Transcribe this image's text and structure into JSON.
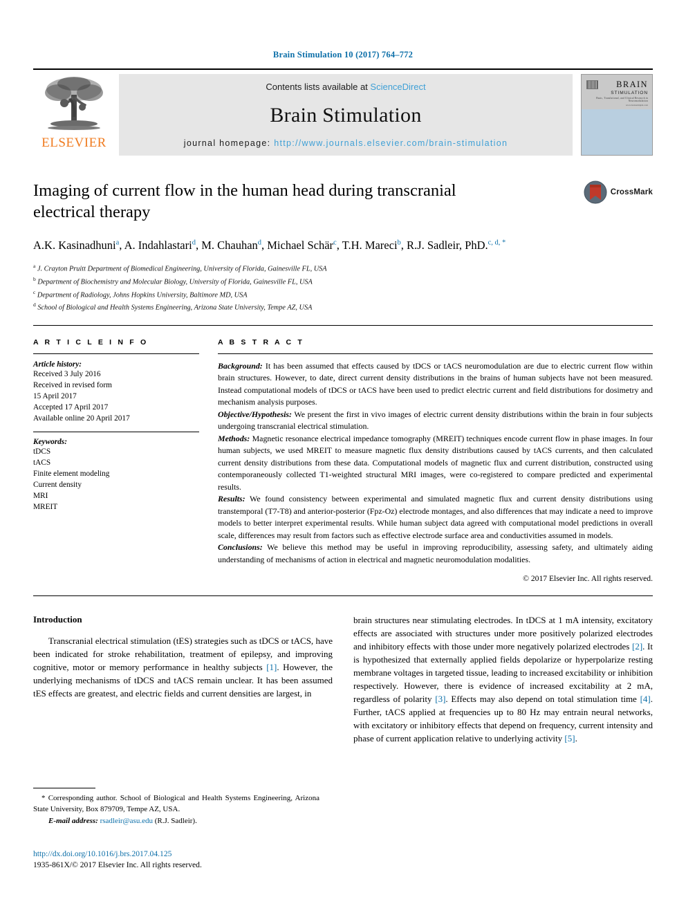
{
  "running_head": "Brain Stimulation 10 (2017) 764–772",
  "masthead": {
    "contents_prefix": "Contents lists available at ",
    "sciencedirect": "ScienceDirect",
    "journal_title": "Brain Stimulation",
    "homepage_prefix": "journal homepage: ",
    "homepage_url": "http://www.journals.elsevier.com/brain-stimulation",
    "publisher": "ELSEVIER",
    "publisher_logo": "elsevier-tree-icon",
    "cover": {
      "line1": "BRAIN",
      "line2": "STIMULATION",
      "line3": "Basic, Translational, and Clinical Research in Neuromodulation",
      "line4": "www.brainstimjrnl.com"
    }
  },
  "title": "Imaging of current flow in the human head during transcranial electrical therapy",
  "crossmark": {
    "label": "CrossMark",
    "icon": "crossmark-icon"
  },
  "authors": [
    {
      "name": "A.K. Kasinadhuni",
      "marks": "a",
      "sep": ", "
    },
    {
      "name": "A. Indahlastari",
      "marks": "d",
      "sep": ", "
    },
    {
      "name": "M. Chauhan",
      "marks": "d",
      "sep": ", "
    },
    {
      "name": "Michael Schär",
      "marks": "c",
      "sep": ", "
    },
    {
      "name": "T.H. Mareci",
      "marks": "b",
      "sep": ", "
    },
    {
      "name": "R.J. Sadleir, PhD.",
      "marks": "c, d, *",
      "sep": ""
    }
  ],
  "authors_text": "A.K. Kasinadhuni a, A. Indahlastari d, M. Chauhan d, Michael Schär c, T.H. Mareci b, R.J. Sadleir, PhD. c, d, *",
  "affiliations": [
    {
      "mark": "a",
      "text": "J. Crayton Pruitt Department of Biomedical Engineering, University of Florida, Gainesville FL, USA"
    },
    {
      "mark": "b",
      "text": "Department of Biochemistry and Molecular Biology, University of Florida, Gainesville FL, USA"
    },
    {
      "mark": "c",
      "text": "Department of Radiology, Johns Hopkins University, Baltimore MD, USA"
    },
    {
      "mark": "d",
      "text": "School of Biological and Health Systems Engineering, Arizona State University, Tempe AZ, USA"
    }
  ],
  "article_info": {
    "heading": "A R T I C L E  I N F O",
    "history_label": "Article history:",
    "history": [
      "Received 3 July 2016",
      "Received in revised form",
      "15 April 2017",
      "Accepted 17 April 2017",
      "Available online 20 April 2017"
    ],
    "keywords_label": "Keywords:",
    "keywords": [
      "tDCS",
      "tACS",
      "Finite element modeling",
      "Current density",
      "MRI",
      "MREIT"
    ]
  },
  "abstract": {
    "heading": "A B S T R A C T",
    "sections": [
      {
        "label": "Background:",
        "text": " It has been assumed that effects caused by tDCS or tACS neuromodulation are due to electric current flow within brain structures. However, to date, direct current density distributions in the brains of human subjects have not been measured. Instead computational models of tDCS or tACS have been used to predict electric current and field distributions for dosimetry and mechanism analysis purposes."
      },
      {
        "label": "Objective/Hypothesis:",
        "text": "  We present the first in vivo images of electric current density distributions within the brain in four subjects undergoing transcranial electrical stimulation."
      },
      {
        "label": "Methods:",
        "text": "  Magnetic resonance electrical impedance tomography (MREIT) techniques encode current flow in phase images. In four human subjects, we used MREIT to measure magnetic flux density distributions caused by tACS currents, and then calculated current density distributions from these data. Computational models of magnetic flux and current distribution, constructed using contemporaneously collected T1-weighted structural MRI images, were co-registered to compare predicted and experimental results."
      },
      {
        "label": "Results:",
        "text": "  We found consistency between experimental and simulated magnetic flux and current density distributions using transtemporal (T7-T8) and anterior-posterior (Fpz-Oz) electrode montages, and also differences that may indicate a need to improve models to better interpret experimental results. While human subject data agreed with computational model predictions in overall scale, differences may result from factors such as effective electrode surface area and conductivities assumed in models."
      },
      {
        "label": "Conclusions:",
        "text": "  We believe this method may be useful in improving reproducibility, assessing safety, and ultimately aiding understanding of mechanisms of action in electrical and magnetic neuromodulation modalities."
      }
    ],
    "copyright": "© 2017 Elsevier Inc. All rights reserved."
  },
  "body": {
    "section_title": "Introduction",
    "left_paragraph_a": "Transcranial electrical stimulation (tES) strategies such as tDCS or tACS, have been indicated for stroke rehabilitation, treatment of epilepsy, and improving cognitive, motor or memory performance in healthy subjects ",
    "left_cite_1": "[1]",
    "left_paragraph_b": ". However, the underlying mechanisms of tDCS and tACS remain unclear. It has been assumed tES effects are greatest, and electric fields and current densities are largest, in",
    "right_paragraph_a": "brain structures near stimulating electrodes. In tDCS at 1 mA intensity, excitatory effects are associated with structures under more positively polarized electrodes and inhibitory effects with those under more negatively polarized electrodes ",
    "right_cite_2": "[2]",
    "right_paragraph_b": ". It is hypothesized that externally applied fields depolarize or hyperpolarize resting membrane voltages in targeted tissue, leading to increased excitability or inhibition respectively. However, there is evidence of increased excitability at 2 mA, regardless of polarity ",
    "right_cite_3": "[3]",
    "right_paragraph_c": ". Effects may also depend on total stimulation time ",
    "right_cite_4": "[4]",
    "right_paragraph_d": ". Further, tACS applied at frequencies up to 80 Hz may entrain neural networks, with excitatory or inhibitory effects that depend on frequency, current intensity and phase of current application relative to underlying activity ",
    "right_cite_5": "[5]",
    "right_paragraph_e": "."
  },
  "footnote": {
    "star": "*",
    "corresponding": " Corresponding author. School of Biological and Health Systems Engineering, Arizona State University, Box 879709, Tempe AZ, USA.",
    "email_label": "E-mail address:",
    "email": "rsadleir@asu.edu",
    "email_owner": "(R.J. Sadleir)."
  },
  "footer": {
    "doi": "http://dx.doi.org/10.1016/j.brs.2017.04.125",
    "issn_line": "1935-861X/© 2017 Elsevier Inc. All rights reserved."
  },
  "colors": {
    "link_blue": "#0b6ea8",
    "sd_blue": "#3fa0d6",
    "elsevier_orange": "#f07c21",
    "masthead_grey": "#e6e6e6",
    "cover_blue": "#b9cfe0"
  }
}
